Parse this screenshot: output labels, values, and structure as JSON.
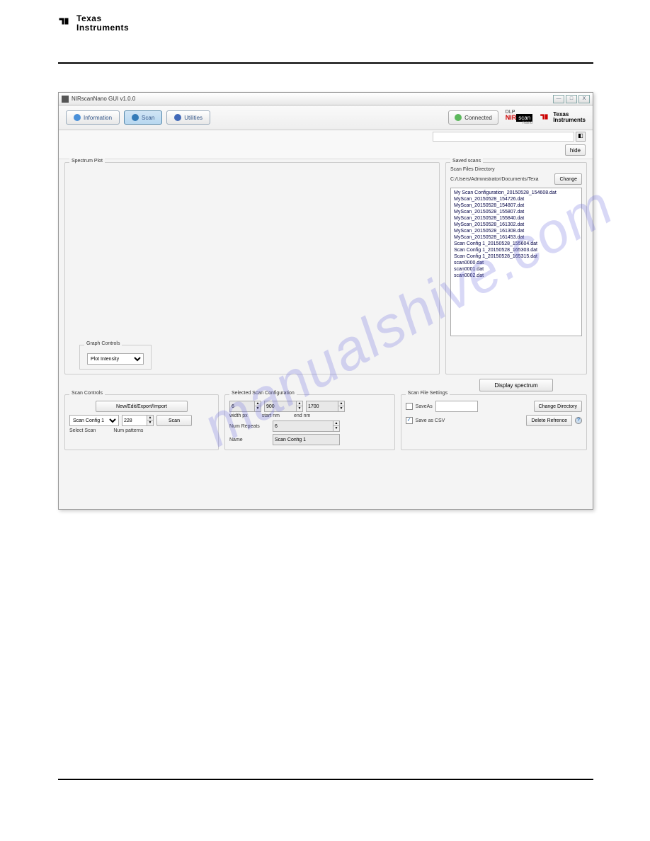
{
  "page_brand": "Texas Instruments",
  "window": {
    "title": "NIRscanNano GUI v1.0.0",
    "min": "—",
    "max": "□",
    "close": "X"
  },
  "toolbar": {
    "information": "Information",
    "scan": "Scan",
    "utilities": "Utilities",
    "connected": "Connected"
  },
  "brands": {
    "dlp": "DLP",
    "nir": "NIR",
    "scan": "scan",
    "nano": "Nano",
    "ti": "Texas",
    "ti2": "Instruments"
  },
  "hide_btn": "hide",
  "spectrum": {
    "title": "Spectrum Plot",
    "graph_controls": "Graph Controls",
    "plot_select": "Plot Intensity"
  },
  "saved": {
    "title": "Saved scans",
    "dir_label": "Scan Files Directory",
    "path": "C:/Users/Administrator/Documents/Texa",
    "change": "Change",
    "display": "Display spectrum",
    "files": [
      "My Scan Configuration_20150528_154608.dat",
      "MyScan_20150528_154726.dat",
      "MyScan_20150528_154807.dat",
      "MyScan_20150528_155807.dat",
      "MyScan_20150528_155840.dat",
      "MyScan_20150528_161302.dat",
      "MyScan_20150528_161308.dat",
      "MyScan_20150528_161453.dat",
      "Scan Config 1_20150528_155604.dat",
      "Scan Config 1_20150528_165303.dat",
      "Scan Config 1_20150528_165315.dat",
      "scan0000.dat",
      "scan0001.dat",
      "scan0002.dat"
    ]
  },
  "scan_controls": {
    "title": "Scan Controls",
    "new_edit": "New/Edit/Export/Import",
    "config": "Scan Config 1",
    "num": "228",
    "scan_btn": "Scan",
    "select_scan": "Select Scan",
    "num_patterns": "Num patterns"
  },
  "selected_config": {
    "title": "Selected Scan Configuration",
    "v1": "6",
    "v2": "900",
    "v3": "1700",
    "width_px": "width px",
    "start_nm": "start nm",
    "end_nm": "end nm",
    "num_repeats_lbl": "Num Repeats",
    "num_repeats_val": "6",
    "name_lbl": "Name",
    "name_val": "Scan Config 1"
  },
  "file_settings": {
    "title": "Scan File Settings",
    "saveas": "SaveAs",
    "saveas_checked": false,
    "change_dir": "Change Directory",
    "save_csv": "Save as CSV",
    "save_csv_checked": true,
    "delete_ref": "Delete Refrence"
  },
  "watermark": "manualshive.com"
}
